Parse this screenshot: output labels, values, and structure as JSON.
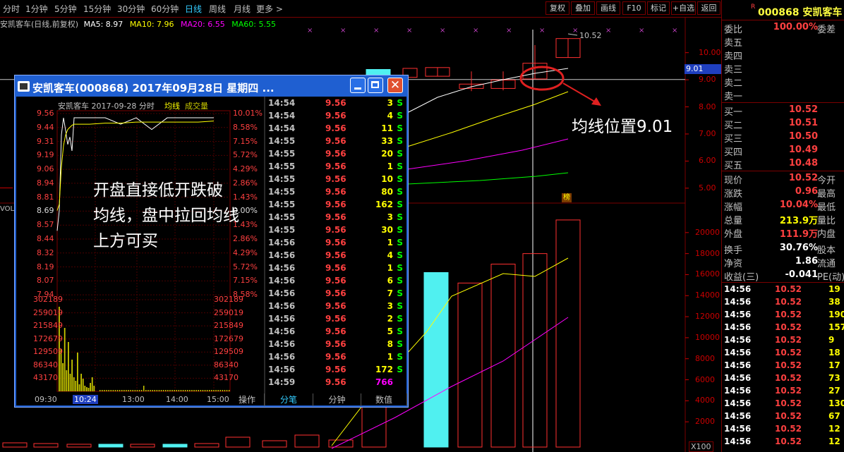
{
  "toolbar": {
    "periods": [
      "分时",
      "1分钟",
      "5分钟",
      "15分钟",
      "30分钟",
      "60分钟",
      "日线",
      "周线",
      "月线",
      "更多 >"
    ],
    "active_period": "日线",
    "buttons": [
      "复权",
      "叠加",
      "画线",
      "F10",
      "标记",
      "+自选",
      "返回"
    ]
  },
  "chart_info": {
    "stock_label": "安凯客车(日线,前复权)",
    "ma5": "MA5: 8.97",
    "ma10": "MA10: 7.96",
    "ma20": "MA20: 6.55",
    "ma60": "MA60: 5.55",
    "colors": {
      "ma5": "#ffffff",
      "ma10": "#ffff00",
      "ma20": "#ff00ff",
      "ma60": "#00ff00"
    }
  },
  "chart_data": {
    "type": "candlestick",
    "price_axis_ticks": [
      "10.00",
      "9.00",
      "8.00",
      "7.00",
      "6.00",
      "5.00"
    ],
    "price_range": [
      4.45,
      10.85
    ],
    "current_price_label": "9.01",
    "high_annotation": "10.52",
    "volume_axis_ticks": [
      "20000",
      "18000",
      "16000",
      "14000",
      "12000",
      "10000",
      "8000",
      "6000",
      "4000",
      "2000"
    ],
    "volume_unit_label": "X100",
    "volume_label": "VOL",
    "badge": "榜",
    "candles_visible": [
      {
        "open": 9.09,
        "close": 9.42,
        "high": 9.42,
        "low": 9.09
      },
      {
        "open": 9.38,
        "close": 9.19,
        "high": 9.38,
        "low": 8.98
      },
      {
        "open": 9.13,
        "close": 9.45,
        "high": 9.45,
        "low": 9.13
      },
      {
        "open": 8.68,
        "close": 8.84,
        "high": 9.31,
        "low": 8.58
      },
      {
        "open": 8.68,
        "close": 8.99,
        "high": 9.31,
        "low": 8.61
      },
      {
        "open": 9.03,
        "close": 9.61,
        "high": 10.28,
        "low": 9.03
      },
      {
        "open": 9.82,
        "close": 10.52,
        "high": 10.52,
        "low": 9.82
      }
    ],
    "volume_x100": [
      3400,
      16200,
      15200,
      17000,
      18000,
      21200
    ]
  },
  "annotations": {
    "ma_position": "均线位置9.01",
    "strategy_note": [
      "开盘直接低开跌破",
      "均线，盘中拉回均线",
      "上方可买"
    ]
  },
  "popup": {
    "title": "安凯客车(000868)  2017年09月28日  星期四  ...",
    "header": "安凯客车   2017-09-28 分时",
    "avg_label": "均线",
    "vol_label": "成交量",
    "price_ticks": [
      "9.56",
      "9.44",
      "9.31",
      "9.19",
      "9.06",
      "8.94",
      "8.81",
      "8.69",
      "8.57",
      "8.44",
      "8.32",
      "8.19",
      "8.07",
      "7.94"
    ],
    "pct_ticks": [
      "10.01%",
      "8.58%",
      "7.15%",
      "5.72%",
      "4.29%",
      "2.86%",
      "1.43%",
      "0.00%",
      "1.43%",
      "2.86%",
      "4.29%",
      "5.72%",
      "7.15%",
      "8.58%"
    ],
    "vol_ticks": [
      "302189",
      "259019",
      "215849",
      "172679",
      "129509",
      "86340",
      "43170"
    ],
    "time_ticks": [
      "09:30",
      "10:24",
      "13:00",
      "14:00",
      "15:00"
    ],
    "minute_price_data": [
      8.5,
      8.69,
      9.4,
      9.56,
      9.44,
      9.31,
      9.38,
      9.25,
      9.56,
      9.56,
      9.56,
      9.5,
      9.56,
      9.45,
      9.56,
      9.56,
      9.56,
      9.56
    ],
    "minute_avg_data": [
      8.69,
      8.75,
      9.1,
      9.3,
      9.4,
      9.45,
      9.47,
      9.49,
      9.5,
      9.5,
      9.51,
      9.51,
      9.52,
      9.52,
      9.52,
      9.52,
      9.52,
      9.53
    ],
    "trades": [
      {
        "time": "14:54",
        "price": "9.56",
        "vol": "3",
        "side": "S"
      },
      {
        "time": "14:54",
        "price": "9.56",
        "vol": "4",
        "side": "S"
      },
      {
        "time": "14:54",
        "price": "9.56",
        "vol": "11",
        "side": "S"
      },
      {
        "time": "14:55",
        "price": "9.56",
        "vol": "33",
        "side": "S"
      },
      {
        "time": "14:55",
        "price": "9.56",
        "vol": "20",
        "side": "S"
      },
      {
        "time": "14:55",
        "price": "9.56",
        "vol": "1",
        "side": "S"
      },
      {
        "time": "14:55",
        "price": "9.56",
        "vol": "10",
        "side": "S"
      },
      {
        "time": "14:55",
        "price": "9.56",
        "vol": "80",
        "side": "S"
      },
      {
        "time": "14:55",
        "price": "9.56",
        "vol": "162",
        "side": "S"
      },
      {
        "time": "14:55",
        "price": "9.56",
        "vol": "3",
        "side": "S"
      },
      {
        "time": "14:55",
        "price": "9.56",
        "vol": "30",
        "side": "S"
      },
      {
        "time": "14:56",
        "price": "9.56",
        "vol": "1",
        "side": "S"
      },
      {
        "time": "14:56",
        "price": "9.56",
        "vol": "4",
        "side": "S"
      },
      {
        "time": "14:56",
        "price": "9.56",
        "vol": "1",
        "side": "S"
      },
      {
        "time": "14:56",
        "price": "9.56",
        "vol": "6",
        "side": "S"
      },
      {
        "time": "14:56",
        "price": "9.56",
        "vol": "7",
        "side": "S"
      },
      {
        "time": "14:56",
        "price": "9.56",
        "vol": "3",
        "side": "S"
      },
      {
        "time": "14:56",
        "price": "9.56",
        "vol": "2",
        "side": "S"
      },
      {
        "time": "14:56",
        "price": "9.56",
        "vol": "5",
        "side": "S"
      },
      {
        "time": "14:56",
        "price": "9.56",
        "vol": "8",
        "side": "S"
      },
      {
        "time": "14:56",
        "price": "9.56",
        "vol": "1",
        "side": "S"
      },
      {
        "time": "14:56",
        "price": "9.56",
        "vol": "172",
        "side": "S"
      },
      {
        "time": "14:59",
        "price": "9.56",
        "vol": "766",
        "side": ""
      }
    ],
    "bottom_tabs": [
      "操作",
      "分笔",
      "分钟",
      "数值"
    ],
    "active_tab": "分笔"
  },
  "quote": {
    "code_name": "000868 安凯客车",
    "r_mark": "R",
    "wei_bi_label": "委比",
    "wei_bi_value": "100.00%",
    "wei_cha_label": "委差",
    "asks": [
      "卖五",
      "卖四",
      "卖三",
      "卖二",
      "卖一"
    ],
    "bids": [
      {
        "label": "买一",
        "price": "10.52"
      },
      {
        "label": "买二",
        "price": "10.51"
      },
      {
        "label": "买三",
        "price": "10.50"
      },
      {
        "label": "买四",
        "price": "10.49"
      },
      {
        "label": "买五",
        "price": "10.48"
      }
    ],
    "stats": [
      {
        "label": "现价",
        "value": "10.52",
        "label2": "今开",
        "color": "#ff4040"
      },
      {
        "label": "涨跌",
        "value": "0.96",
        "label2": "最高",
        "color": "#ff4040"
      },
      {
        "label": "涨幅",
        "value": "10.04%",
        "label2": "最低",
        "color": "#ff4040"
      },
      {
        "label": "总量",
        "value": "213.9万",
        "label2": "量比",
        "color": "#ffff00"
      },
      {
        "label": "外盘",
        "value": "111.9万",
        "label2": "内盘",
        "color": "#ff4040"
      },
      {
        "label": "换手",
        "value": "30.76%",
        "label2": "股本",
        "color": "#ffffff"
      },
      {
        "label": "净资",
        "value": "1.86",
        "label2": "流通",
        "color": "#ffffff"
      },
      {
        "label": "收益(三)",
        "value": "-0.041",
        "label2": "PE(动)",
        "color": "#ffffff"
      }
    ],
    "ticks": [
      {
        "time": "14:56",
        "price": "10.52",
        "vol": "19"
      },
      {
        "time": "14:56",
        "price": "10.52",
        "vol": "38"
      },
      {
        "time": "14:56",
        "price": "10.52",
        "vol": "190"
      },
      {
        "time": "14:56",
        "price": "10.52",
        "vol": "157"
      },
      {
        "time": "14:56",
        "price": "10.52",
        "vol": "9"
      },
      {
        "time": "14:56",
        "price": "10.52",
        "vol": "18"
      },
      {
        "time": "14:56",
        "price": "10.52",
        "vol": "17"
      },
      {
        "time": "14:56",
        "price": "10.52",
        "vol": "73"
      },
      {
        "time": "14:56",
        "price": "10.52",
        "vol": "27"
      },
      {
        "time": "14:56",
        "price": "10.52",
        "vol": "130"
      },
      {
        "time": "14:56",
        "price": "10.52",
        "vol": "67"
      },
      {
        "time": "14:56",
        "price": "10.52",
        "vol": "12"
      },
      {
        "time": "14:56",
        "price": "10.52",
        "vol": "12"
      }
    ]
  }
}
